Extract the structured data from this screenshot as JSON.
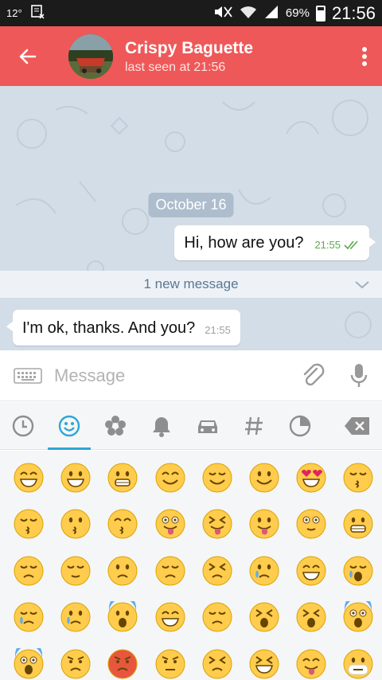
{
  "status_bar": {
    "left_text": "12°",
    "battery": "69%",
    "time": "21:56"
  },
  "header": {
    "title": "Crispy Baguette",
    "subtitle": "last seen at 21:56",
    "icons": {
      "back": "back-arrow-icon",
      "menu": "overflow-menu-icon"
    }
  },
  "chat": {
    "date": "October 16",
    "outgoing": {
      "text": "Hi, how are you?",
      "time": "21:55",
      "status": "read"
    },
    "new_message_banner": "1 new message",
    "incoming": {
      "text": "I'm ok, thanks. And you?",
      "time": "21:55"
    }
  },
  "composer": {
    "placeholder": "Message",
    "icons": {
      "keyboard": "keyboard-icon",
      "attach": "paperclip-icon",
      "mic": "microphone-icon"
    }
  },
  "emoji_tabs": [
    {
      "name": "recent-icon",
      "active": false
    },
    {
      "name": "smiley-icon",
      "active": true
    },
    {
      "name": "flower-icon",
      "active": false
    },
    {
      "name": "bell-icon",
      "active": false
    },
    {
      "name": "car-icon",
      "active": false
    },
    {
      "name": "hash-icon",
      "active": false
    },
    {
      "name": "moon-icon",
      "active": false
    }
  ],
  "emoji_backspace": "backspace-icon",
  "emoji_rows": [
    [
      "grinning-smiling-eyes",
      "smiley",
      "grinning",
      "blush",
      "relaxed",
      "wink",
      "heart-eyes",
      "kissing-heart"
    ],
    [
      "kissing-closed-eyes",
      "kissing",
      "kissing-smiling-eyes",
      "stuck-out-tongue-winking-eye",
      "stuck-out-tongue-closed-eyes",
      "stuck-out-tongue",
      "flushed",
      "grimacing"
    ],
    [
      "pensive",
      "relieved",
      "unamused",
      "disappointed",
      "persevere",
      "cry",
      "joy",
      "sob"
    ],
    [
      "sleepy",
      "disappointed-relieved",
      "cold-sweat",
      "sweat-smile",
      "sweat",
      "weary",
      "tired-face",
      "fearful"
    ],
    [
      "scream",
      "angry",
      "rage",
      "triumph",
      "confounded",
      "laughing",
      "yum",
      "mask"
    ]
  ],
  "colors": {
    "header": "#ef5858",
    "chat_bg": "#d3dde7",
    "tab_accent": "#2ea6d7",
    "read_check": "#5aaa4c"
  }
}
